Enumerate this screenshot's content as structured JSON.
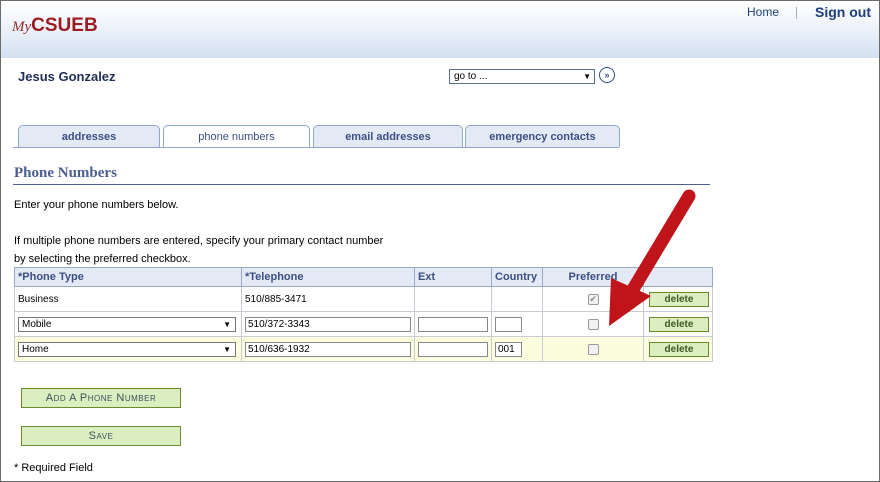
{
  "header": {
    "logo_my": "My",
    "logo_name": "CSUEB",
    "home_link": "Home",
    "signout_link": "Sign out"
  },
  "user": {
    "name": "Jesus Gonzalez"
  },
  "goto": {
    "value": "go to ...",
    "go_icon": "double-chevron-right-icon"
  },
  "tabs": [
    {
      "label": "addresses"
    },
    {
      "label": "phone numbers",
      "active": true
    },
    {
      "label": "email addresses"
    },
    {
      "label": "emergency contacts"
    }
  ],
  "section": {
    "title": "Phone Numbers",
    "instruction": "Enter your phone numbers below.",
    "note_line1": "If multiple phone numbers are entered, specify your primary contact number",
    "note_line2": "by selecting the preferred checkbox."
  },
  "table": {
    "headers": {
      "type": "*Phone Type",
      "telephone": "*Telephone",
      "ext": "Ext",
      "country": "Country",
      "preferred": "Preferred"
    },
    "rows": [
      {
        "type": "Business",
        "telephone": "510/885-3471",
        "ext": "",
        "country": "",
        "preferred": true,
        "delete": "delete"
      },
      {
        "type": "Mobile",
        "telephone": "510/372-3343",
        "ext": "",
        "country": "",
        "preferred": false,
        "delete": "delete"
      },
      {
        "type": "Home",
        "telephone": "510/636-1932",
        "ext": "",
        "country": "001",
        "preferred": false,
        "delete": "delete"
      }
    ]
  },
  "buttons": {
    "add_phone": "Add A Phone Number",
    "save": "Save"
  },
  "footer": {
    "required": "* Required Field"
  },
  "colors": {
    "brand": "#9b1c20",
    "accent": "#3d4f84",
    "arrow": "#c0141b"
  }
}
